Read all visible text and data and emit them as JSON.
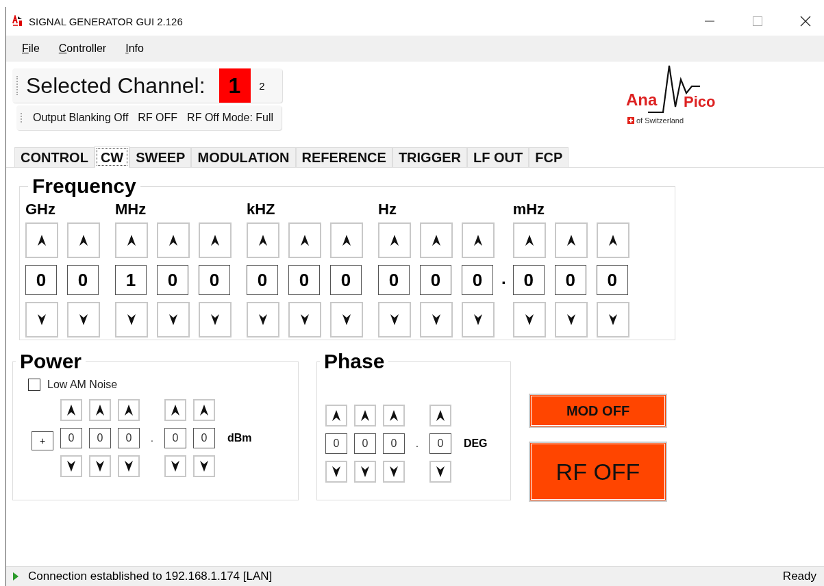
{
  "window": {
    "title": "SIGNAL GENERATOR GUI 2.126"
  },
  "menu": [
    {
      "label": "File"
    },
    {
      "label": "Controller"
    },
    {
      "label": "Info"
    }
  ],
  "channel_bar": {
    "label": "Selected Channel:",
    "channels": [
      {
        "label": "1",
        "selected": true
      },
      {
        "label": "2",
        "selected": false
      }
    ]
  },
  "status_strip": [
    "Output Blanking Off",
    "RF OFF",
    "RF Off Mode: Full"
  ],
  "logo": {
    "left": "Ana",
    "right": "Pico",
    "tagline": "of Switzerland"
  },
  "tabs": [
    {
      "label": "CONTROL",
      "selected": false
    },
    {
      "label": "CW",
      "selected": true
    },
    {
      "label": "SWEEP",
      "selected": false
    },
    {
      "label": "MODULATION",
      "selected": false
    },
    {
      "label": "REFERENCE",
      "selected": false
    },
    {
      "label": "TRIGGER",
      "selected": false
    },
    {
      "label": "LF OUT",
      "selected": false
    },
    {
      "label": "FCP",
      "selected": false
    }
  ],
  "frequency": {
    "title": "Frequency",
    "groups": [
      {
        "kind": "digits",
        "unit": "GHz",
        "digits": [
          "0",
          "0"
        ]
      },
      {
        "kind": "digits",
        "unit": "MHz",
        "digits": [
          "1",
          "0",
          "0"
        ]
      },
      {
        "kind": "digits",
        "unit": "kHZ",
        "digits": [
          "0",
          "0",
          "0"
        ]
      },
      {
        "kind": "digits",
        "unit": "Hz",
        "digits": [
          "0",
          "0",
          "0"
        ]
      },
      {
        "kind": "point",
        "text": "."
      },
      {
        "kind": "digits",
        "unit": "mHz",
        "digits": [
          "0",
          "0",
          "0"
        ]
      }
    ]
  },
  "power": {
    "title": "Power",
    "low_am_noise": {
      "label": "Low AM Noise",
      "checked": false
    },
    "sign": "+",
    "groups": [
      {
        "kind": "digits",
        "digits": [
          "0",
          "0",
          "0"
        ]
      },
      {
        "kind": "point",
        "text": "."
      },
      {
        "kind": "digits",
        "digits": [
          "0",
          "0"
        ]
      }
    ],
    "unit": "dBm"
  },
  "phase": {
    "title": "Phase",
    "groups": [
      {
        "kind": "digits",
        "digits": [
          "0",
          "0",
          "0"
        ]
      },
      {
        "kind": "point",
        "text": "."
      },
      {
        "kind": "digits",
        "digits": [
          "0"
        ]
      }
    ],
    "unit": "DEG"
  },
  "buttons": {
    "modulation": "MOD OFF",
    "rf": "RF OFF"
  },
  "status_bar": {
    "message": "Connection established to 192.168.1.174 [LAN]",
    "state": "Ready"
  }
}
